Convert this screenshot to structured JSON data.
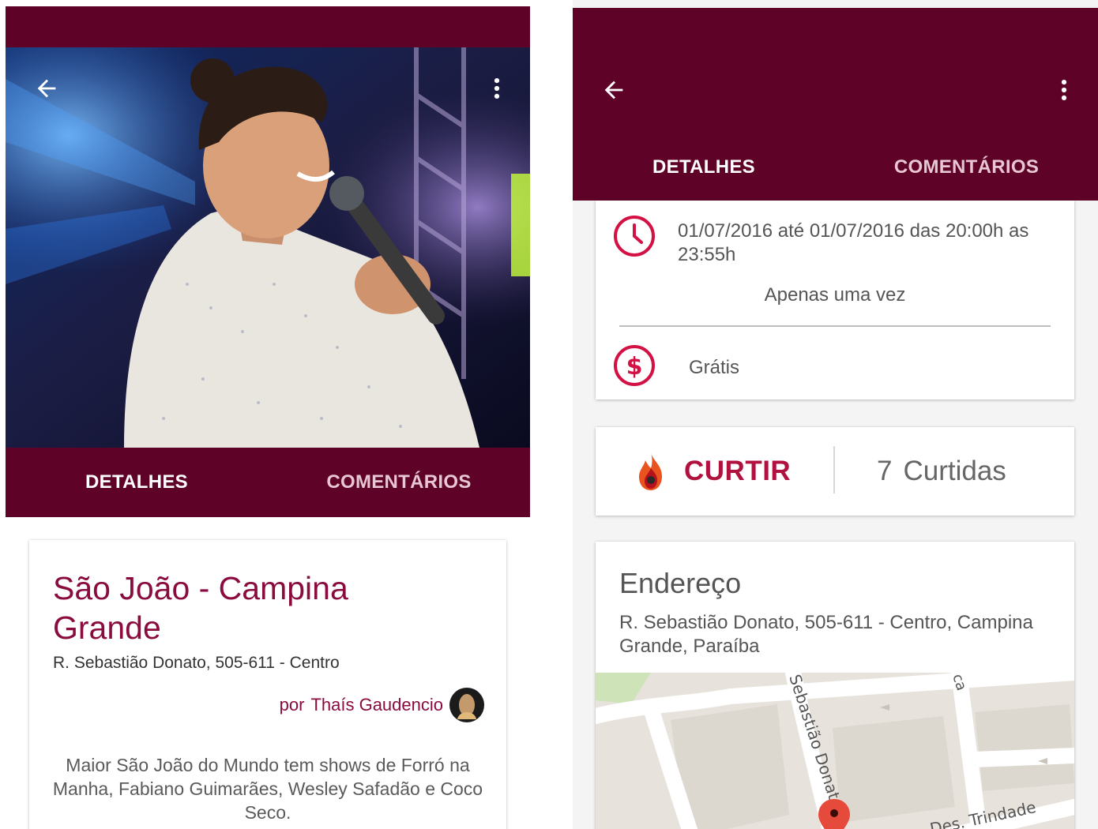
{
  "left_screen": {
    "tabs": [
      {
        "label": "DETALHES",
        "active": true
      },
      {
        "label": "COMENTÁRIOS",
        "active": false
      }
    ],
    "event": {
      "title": "São João - Campina Grande",
      "address": "R. Sebastião Donato, 505-611 - Centro",
      "author_prefix": "por",
      "author_name": "Thaís Gaudencio",
      "description": "Maior São João do Mundo tem shows de Forró na Manha, Fabiano Guimarães, Wesley Safadão e Coco Seco."
    }
  },
  "right_screen": {
    "tabs": [
      {
        "label": "DETALHES",
        "active": true
      },
      {
        "label": "COMENTÁRIOS",
        "active": false
      }
    ],
    "schedule": {
      "date_range": "01/07/2016 até 01/07/2016 das 20:00h as 23:55h",
      "recurrence": "Apenas uma vez"
    },
    "price": "Grátis",
    "like": {
      "button_label": "CURTIR",
      "count": "7",
      "count_label": "Curtidas"
    },
    "address": {
      "title": "Endereço",
      "full": "R. Sebastião Donato, 505-611 - Centro, Campina Grande, Paraíba"
    },
    "map": {
      "street_labels": {
        "main": "Sebastião Donato",
        "cross": "Des. Trindade",
        "corner": "ca"
      }
    }
  },
  "icons": {
    "back": "arrow-back-icon",
    "overflow": "more-vert-icon",
    "clock": "clock-icon",
    "price": "dollar-icon",
    "like": "flame-icon",
    "map_pin": "map-pin-icon"
  },
  "colors": {
    "brand_dark": "#5e0228",
    "accent": "#b0113f",
    "title": "#8a0c3e"
  }
}
